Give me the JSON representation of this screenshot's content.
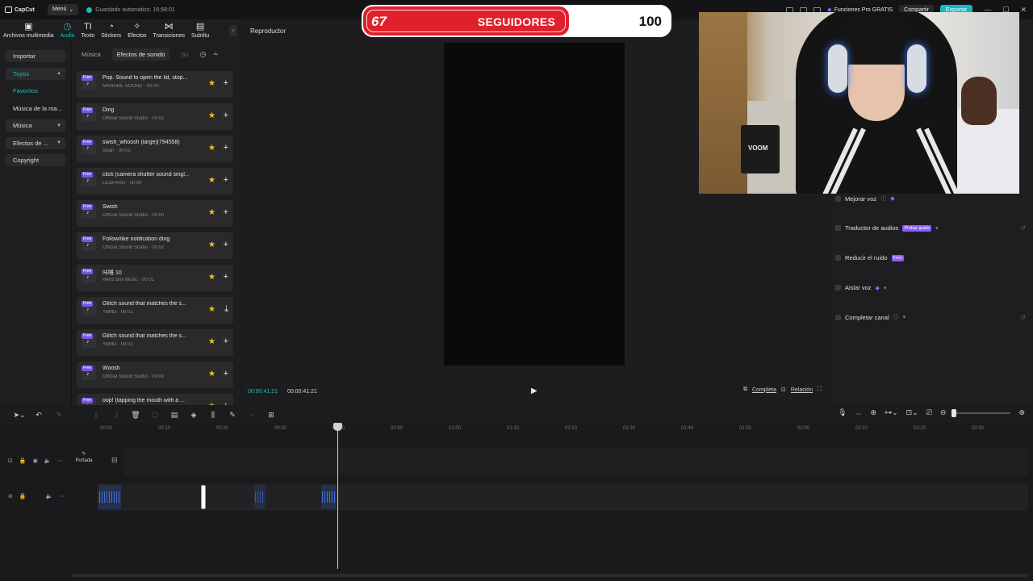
{
  "app": {
    "name": "CapCut",
    "menu_label": "Menú",
    "autosave": "Guardado automático: 16:58:01",
    "pro_label": "Funciones Pro GRATIS",
    "share_label": "Compartir",
    "export_label": "Exportar"
  },
  "overlay": {
    "current": "67",
    "label": "SEGUIDORES",
    "max": "100",
    "fill_fraction": 0.67
  },
  "toolbar": [
    {
      "label": "Archivos multimedia",
      "icon": "▣"
    },
    {
      "label": "Audio",
      "icon": "◷",
      "active": true
    },
    {
      "label": "Texto",
      "icon": "TI"
    },
    {
      "label": "Stickers",
      "icon": "◔"
    },
    {
      "label": "Efectos",
      "icon": "✧"
    },
    {
      "label": "Transiciones",
      "icon": "⋈"
    },
    {
      "label": "Subtítu",
      "icon": "▤"
    }
  ],
  "leftnav": [
    {
      "label": "Importar",
      "boxed": true
    },
    {
      "label": "Tuyos",
      "boxed": true,
      "active": true,
      "caret": "▲"
    },
    {
      "label": "Favoritos",
      "active": true
    },
    {
      "label": "Música de la ma..."
    },
    {
      "label": "Música",
      "boxed": true,
      "caret": "▼"
    },
    {
      "label": "Efectos de ...",
      "boxed": true,
      "caret": "▼"
    },
    {
      "label": "Copyright",
      "boxed": true
    }
  ],
  "subtabs": [
    "Música",
    "Efectos de sonido",
    "So"
  ],
  "sounds": [
    {
      "title": "Pop. Sound to open the lid, stop...",
      "meta": "MANURE SOUND · 00:00",
      "action": "+"
    },
    {
      "title": "Ding",
      "meta": "Official Sound Studio · 00:02",
      "action": "+"
    },
    {
      "title": "swish_whoosh (large)(794558)",
      "meta": "sstan · 00:01",
      "action": "+"
    },
    {
      "title": "click (camera shutter sound singl...",
      "meta": "LEOPARD · 00:00",
      "action": "+"
    },
    {
      "title": "Swish",
      "meta": "Official Sound Studio · 00:00",
      "action": "+"
    },
    {
      "title": "Follow/like notification ding",
      "meta": "Official Sound Studio · 00:02",
      "action": "+"
    },
    {
      "title": "咔嗒 10",
      "meta": "Hertz Box Music · 00:01",
      "action": "+"
    },
    {
      "title": "Glitch sound that matches the s...",
      "meta": "YBMD · 00:01",
      "action": "⤓"
    },
    {
      "title": "Glitch sound that matches the s...",
      "meta": "YBMD · 00:01",
      "action": "+"
    },
    {
      "title": "Woosh",
      "meta": "Official Sound Studio · 00:00",
      "action": "+"
    },
    {
      "title": "oop! (tapping the mouth with a ...",
      "meta": "",
      "action": "+"
    }
  ],
  "free_badge": "Free",
  "player": {
    "title": "Reproductor",
    "current": "00:00:41:21",
    "total": "00:00:41:21",
    "btn_complete": "Completa",
    "btn_ratio": "Relación"
  },
  "rightpanel": [
    {
      "label": "Mejorar voz",
      "info": true,
      "gem": true
    },
    {
      "label": "Traductor de audios",
      "tag": "Probar gratis",
      "caret": true,
      "reset": true
    },
    {
      "label": "Reducir el ruido",
      "tag": "Free"
    },
    {
      "label": "Aislar voz",
      "gem": true,
      "caret": true
    },
    {
      "label": "Completar canal",
      "info": true,
      "caret": true,
      "reset": true
    }
  ],
  "webcam": {
    "bag_text": "VOOM"
  },
  "timeline": {
    "cover_label": "Portada",
    "ruler": [
      "00:00",
      "00:10",
      "00:20",
      "00:30",
      "00:40",
      "00:50",
      "01:00",
      "01:10",
      "01:20",
      "01:30",
      "01:40",
      "01:50",
      "02:00",
      "02:10",
      "02:20",
      "02:30"
    ]
  }
}
